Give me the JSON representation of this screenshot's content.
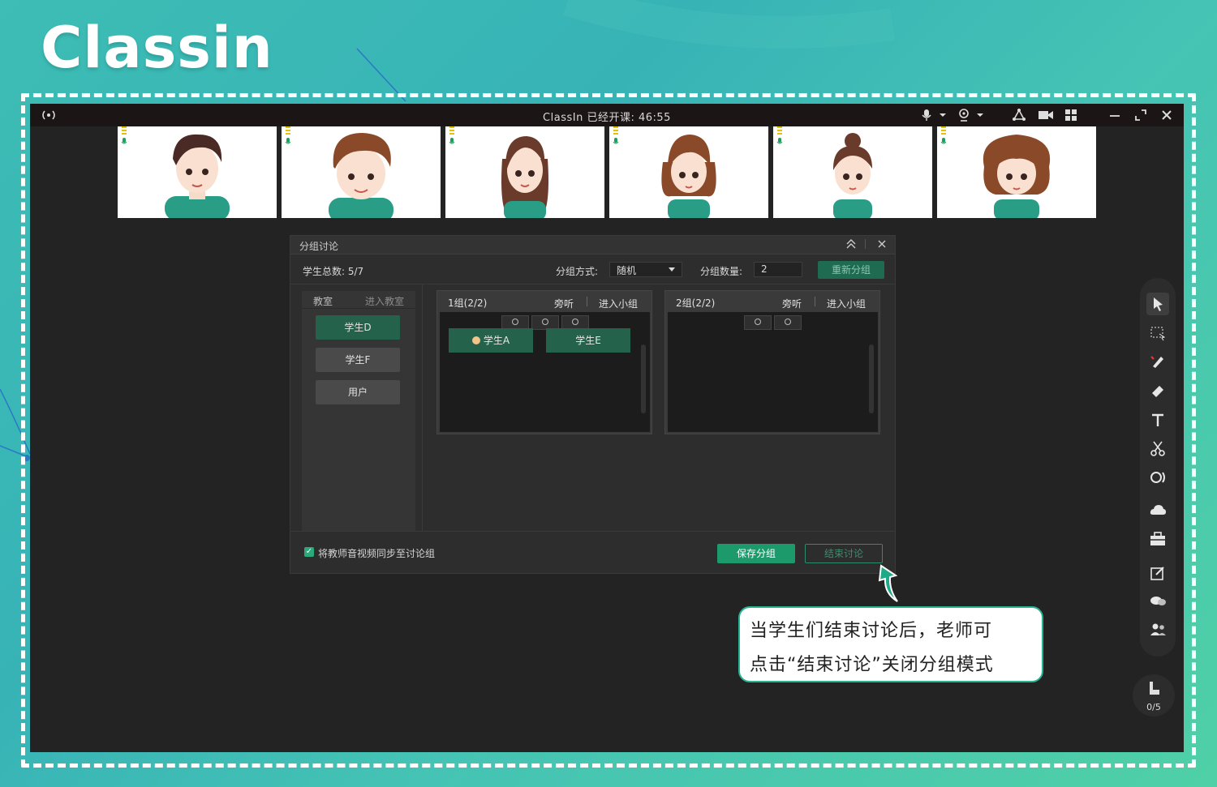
{
  "brand": {
    "logo_text": "Classin"
  },
  "window": {
    "title": "ClassIn   已经开课: 46:55"
  },
  "videos": [
    {
      "name": "teacher-boy-1"
    },
    {
      "name": "student-boy-2"
    },
    {
      "name": "student-girl-1"
    },
    {
      "name": "student-girl-2"
    },
    {
      "name": "student-girl-3"
    },
    {
      "name": "student-girl-4"
    }
  ],
  "dialog": {
    "title": "分组讨论",
    "total_label": "学生总数: 5/7",
    "mode_label": "分组方式:",
    "mode_value": "随机",
    "count_label": "分组数量:",
    "count_value": "2",
    "regroup_button": "重新分组",
    "left_panel": {
      "title": "教室",
      "enter": "进入教室",
      "students": [
        "学生D",
        "学生F",
        "用户"
      ]
    },
    "groups": [
      {
        "title": "1组(2/2)",
        "listen": "旁听",
        "enter": "进入小组",
        "members": [
          "学生A",
          "学生E"
        ]
      },
      {
        "title": "2组(2/2)",
        "listen": "旁听",
        "enter": "进入小组",
        "members": []
      }
    ],
    "sync_checkbox_label": "将教师音视频同步至讨论组",
    "save_button": "保存分组",
    "end_button": "结束讨论"
  },
  "hand_count": "0/5",
  "callout": {
    "line1": "当学生们结束讨论后，老师可",
    "line2": "点击“结束讨论”关闭分组模式"
  },
  "colors": {
    "accent_green": "#1c9a6c",
    "bg_teal": "#3dbdb5",
    "app_bg": "#232323"
  }
}
